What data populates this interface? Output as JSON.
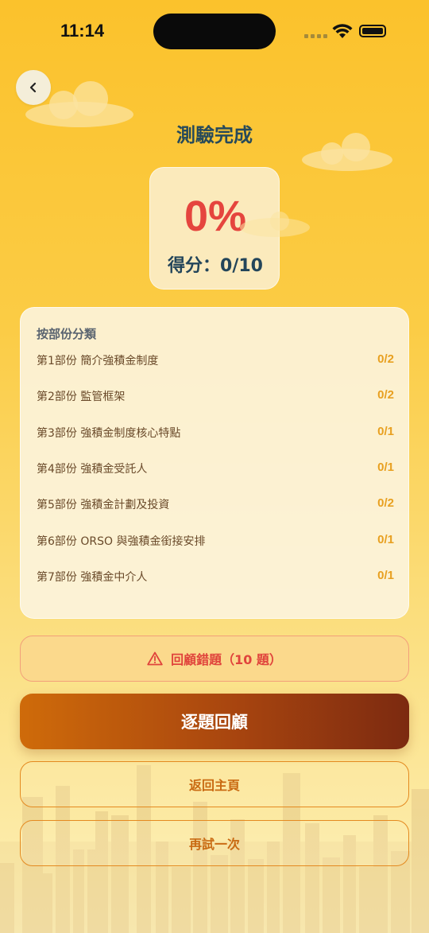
{
  "status_bar": {
    "time": "11:14"
  },
  "header": {
    "back_icon": "chevron-left-icon",
    "title": "測驗完成"
  },
  "score": {
    "percent": "0%",
    "label": "得分：0/10"
  },
  "breakdown": {
    "heading": "按部份分類",
    "parts": [
      {
        "name": "第1部份 簡介強積金制度",
        "score": "0/2"
      },
      {
        "name": "第2部份 監管框架",
        "score": "0/2"
      },
      {
        "name": "第3部份 強積金制度核心特點",
        "score": "0/1"
      },
      {
        "name": "第4部份 強積金受託人",
        "score": "0/1"
      },
      {
        "name": "第5部份 強積金計劃及投資",
        "score": "0/2"
      },
      {
        "name": "第6部份 ORSO 與強積金銜接安排",
        "score": "0/1"
      },
      {
        "name": "第7部份 強積金中介人",
        "score": "0/1"
      }
    ]
  },
  "actions": {
    "review_wrong": {
      "icon": "warning-icon",
      "label": "回顧錯題（10 題）"
    },
    "review_each": "逐題回顧",
    "home": "返回主頁",
    "retry": "再試一次"
  },
  "colors": {
    "accent": "#e5453e",
    "title": "#274a5a",
    "score_value": "#e8a020",
    "primary_start": "#cf6b0a",
    "primary_end": "#7c2a10"
  }
}
